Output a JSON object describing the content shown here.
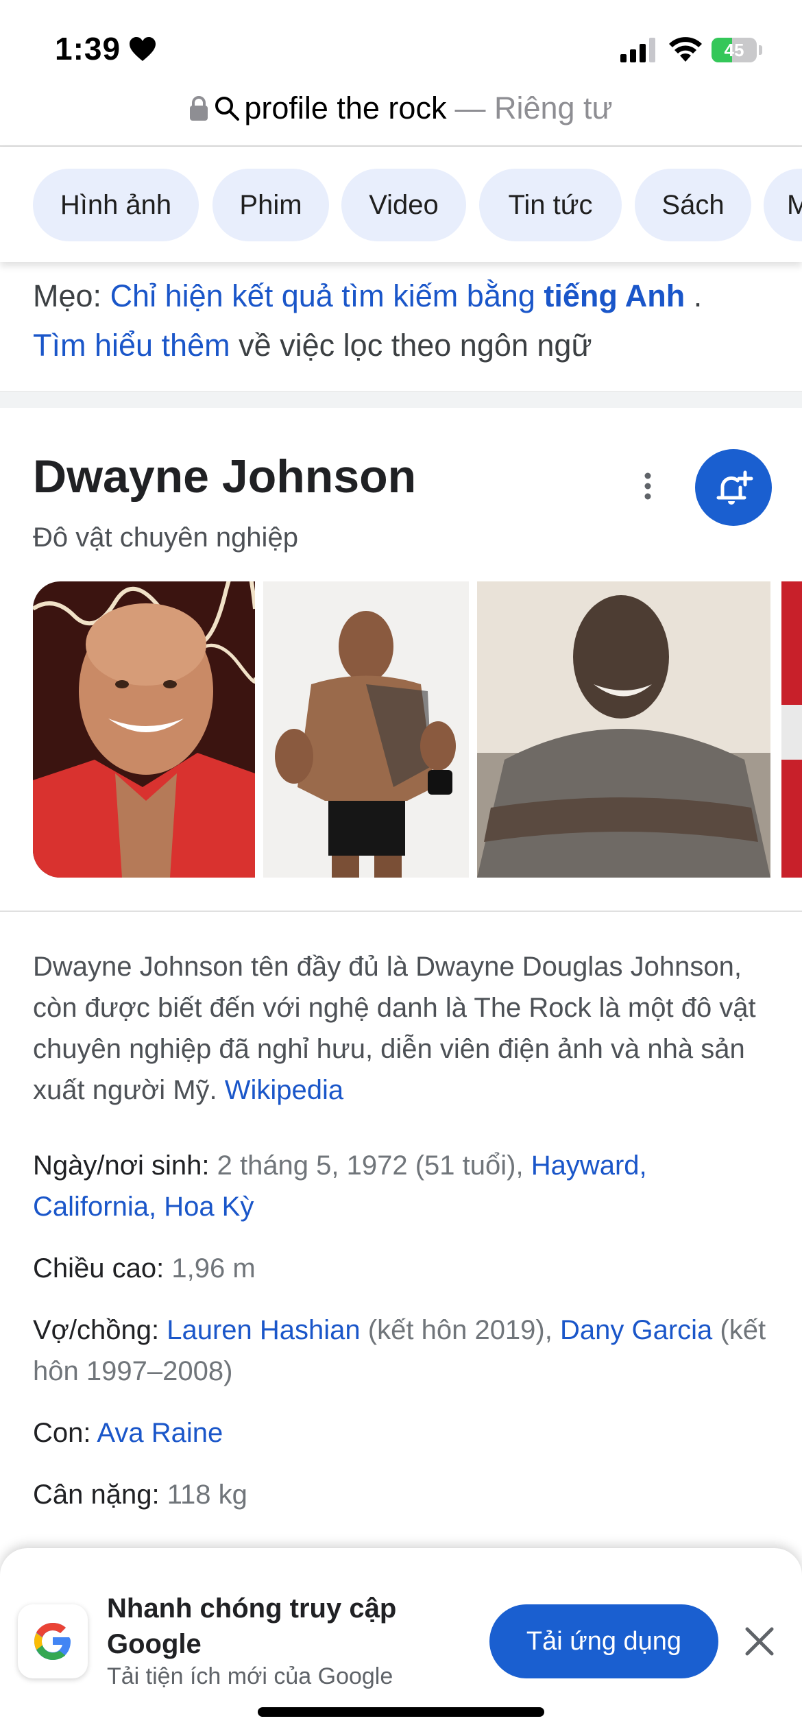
{
  "status_bar": {
    "time": "1:39",
    "battery_percent": 45,
    "battery_label": "45"
  },
  "url_bar": {
    "query": "profile the rock",
    "suffix": "— Riêng tư"
  },
  "chips": [
    "Hình ảnh",
    "Phim",
    "Video",
    "Tin tức",
    "Sách",
    "M"
  ],
  "tip": {
    "prefix": "Mẹo:",
    "link_text": "Chỉ hiện kết quả tìm kiếm bằng",
    "lang": "tiếng Anh",
    "dot": ".",
    "learn_link": "Tìm hiểu thêm",
    "learn_rest": "về việc lọc theo ngôn ngữ"
  },
  "knowledge_panel": {
    "title": "Dwayne Johnson",
    "subtitle": "Đô vật chuyên nghiệp",
    "description": "Dwayne Johnson tên đầy đủ là Dwayne Douglas Johnson, còn được biết đến với nghệ danh là The Rock là một đô vật chuyên nghiệp đã nghỉ hưu, diễn viên điện ảnh và nhà sản xuất người Mỹ.",
    "source": "Wikipedia",
    "facts": {
      "birth": {
        "label": "Ngày/nơi sinh:",
        "value": "2 tháng 5, 1972 (51 tuổi),",
        "link": "Hayward, California, Hoa Kỳ"
      },
      "height": {
        "label": "Chiều cao:",
        "value": "1,96 m"
      },
      "spouse": {
        "label": "Vợ/chồng:",
        "link1": "Lauren Hashian",
        "value1": "(kết hôn 2019),",
        "link2": "Dany Garcia",
        "value2": "(kết hôn 1997–2008)"
      },
      "children": {
        "label": "Con:",
        "link": "Ava Raine"
      },
      "weight": {
        "label": "Cân nặng:",
        "value": "118 kg"
      }
    }
  },
  "app_banner": {
    "title": "Nhanh chóng truy cập Google",
    "subtitle": "Tải tiện ích mới của Google",
    "button": "Tải ứng dụng"
  },
  "colors": {
    "accent": "#1a5fd0",
    "link": "#1a56c9",
    "chip_bg": "#e8eefc"
  }
}
